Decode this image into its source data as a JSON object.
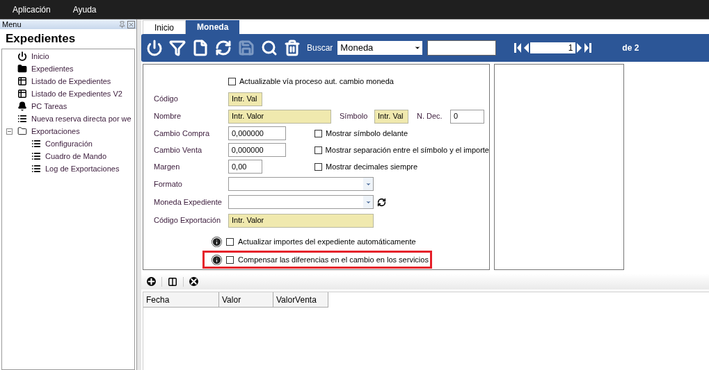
{
  "menubar": [
    {
      "label": "Aplicación"
    },
    {
      "label": "Ayuda"
    }
  ],
  "sidebar": {
    "header": "Menu",
    "title": "Expedientes",
    "items": [
      {
        "label": "Inicio",
        "kind": "power"
      },
      {
        "label": "Expedientes",
        "kind": "folder"
      },
      {
        "label": "Listado de Expedientes",
        "kind": "report"
      },
      {
        "label": "Listado de Expedientes V2",
        "kind": "report"
      },
      {
        "label": "PC Tareas",
        "kind": "bell"
      },
      {
        "label": "Nueva reserva directa por we",
        "kind": "list"
      },
      {
        "label": "Exportaciones",
        "kind": "group",
        "expanded": true,
        "children": [
          {
            "label": "Configuración",
            "kind": "list"
          },
          {
            "label": "Cuadro de Mando",
            "kind": "list"
          },
          {
            "label": "Log de Exportaciones",
            "kind": "list"
          }
        ]
      }
    ]
  },
  "tabs": [
    {
      "label": "Inicio",
      "selected": false
    },
    {
      "label": "Moneda",
      "selected": true
    }
  ],
  "toolbar": {
    "buttons": [
      {
        "disabled": false
      },
      {
        "disabled": false
      },
      {
        "disabled": false
      },
      {
        "disabled": false
      },
      {
        "disabled": true
      },
      {
        "disabled": false
      },
      {
        "disabled": false
      }
    ],
    "search_label": "Buscar",
    "search_select": "Moneda",
    "page": "1",
    "page_total": "de 2"
  },
  "form": {
    "auto_update": {
      "label": "Actualizable vía proceso aut. cambio moneda",
      "checked": false
    },
    "codigo": {
      "label": "Código",
      "value": "Intr. Val",
      "readonly": true
    },
    "nombre": {
      "label": "Nombre",
      "value": "Intr. Valor",
      "readonly": true
    },
    "simbolo": {
      "label": "Símbolo",
      "value": "Intr. Val",
      "readonly": true
    },
    "decimales": {
      "label": "N. Dec.",
      "value": "0",
      "readonly": false
    },
    "cambio_compra": {
      "label": "Cambio Compra",
      "value": "0,000000",
      "readonly": false
    },
    "cambio_venta": {
      "label": "Cambio Venta",
      "value": "0,000000",
      "readonly": false
    },
    "margen": {
      "label": "Margen",
      "value": "0,00",
      "readonly": false
    },
    "options": [
      {
        "label": "Mostrar símbolo delante",
        "checked": false
      },
      {
        "label": "Mostrar separación entre el símbolo y el importe",
        "checked": false
      },
      {
        "label": "Mostrar decimales siempre",
        "checked": false
      }
    ],
    "formato": {
      "label": "Formato"
    },
    "moneda_expediente": {
      "label": "Moneda Expediente"
    },
    "codigo_exportacion": {
      "label": "Código Exportación",
      "value": "Intr. Valor",
      "readonly": true
    },
    "info_options": [
      {
        "label": "Actualizar importes del expediente automáticamente",
        "checked": false,
        "highlighted": false
      },
      {
        "label": "Compensar las diferencias en el cambio en los servicios",
        "checked": false,
        "highlighted": true
      }
    ]
  },
  "grid": {
    "columns": [
      "Fecha",
      "Valor",
      "ValorVenta"
    ]
  }
}
